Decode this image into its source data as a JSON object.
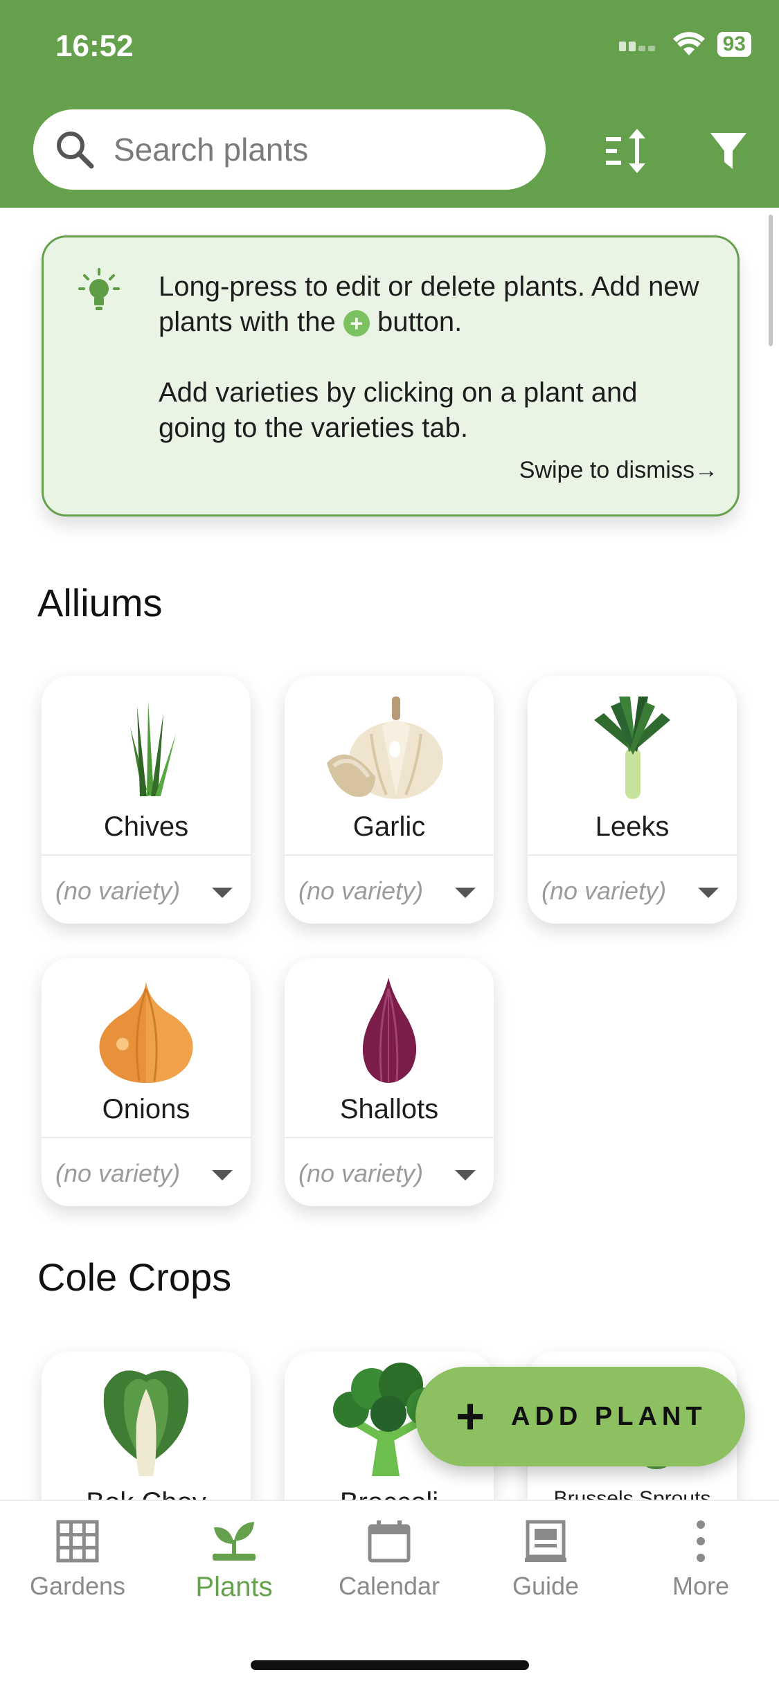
{
  "status": {
    "time": "16:52",
    "battery": "93"
  },
  "search": {
    "placeholder": "Search plants"
  },
  "header_icons": {
    "sort": "sort-icon",
    "filter": "filter-icon",
    "search": "search-icon"
  },
  "tip": {
    "icon": "lightbulb-icon",
    "line1_before": "Long-press to edit or delete plants. Add new plants with the",
    "line1_after": "button.",
    "line2": "Add varieties by clicking on a plant and going to the varieties tab.",
    "dismiss": "Swipe to dismiss"
  },
  "sections": [
    {
      "title": "Alliums",
      "plants": [
        {
          "name": "Chives",
          "variety": "(no variety)",
          "icon": "chives-icon"
        },
        {
          "name": "Garlic",
          "variety": "(no variety)",
          "icon": "garlic-icon"
        },
        {
          "name": "Leeks",
          "variety": "(no variety)",
          "icon": "leeks-icon"
        },
        {
          "name": "Onions",
          "variety": "(no variety)",
          "icon": "onion-icon"
        },
        {
          "name": "Shallots",
          "variety": "(no variety)",
          "icon": "shallot-icon"
        }
      ]
    },
    {
      "title": "Cole Crops",
      "plants": [
        {
          "name": "Bok Choy",
          "icon": "bok-choy-icon"
        },
        {
          "name": "Broccoli",
          "icon": "broccoli-icon"
        },
        {
          "name": "Brussels Sprouts",
          "icon": "brussels-sprouts-icon"
        }
      ]
    }
  ],
  "fab": {
    "label": "ADD PLANT"
  },
  "nav": [
    {
      "label": "Gardens",
      "icon": "grid-icon"
    },
    {
      "label": "Plants",
      "icon": "sprout-icon",
      "active": true
    },
    {
      "label": "Calendar",
      "icon": "calendar-icon"
    },
    {
      "label": "Guide",
      "icon": "guide-icon"
    },
    {
      "label": "More",
      "icon": "more-icon"
    }
  ],
  "colors": {
    "accent": "#65a14c",
    "fab": "#8dc060",
    "tip_bg": "#e9f4e5"
  }
}
